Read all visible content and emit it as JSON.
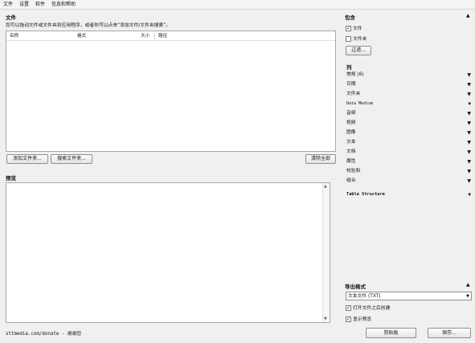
{
  "menu": [
    "文件",
    "设置",
    "软件",
    "信息和帮助"
  ],
  "files": {
    "title": "文件",
    "hint": "您可以拖动文件或文件夹到应用程序，或者你可以点击“添加文件/文件夹搜索”。",
    "columns": {
      "name": "名称",
      "format": "格式",
      "size": "大小",
      "path": "路径"
    },
    "add_files": "添加文件夹...",
    "search_files": "搜索文件夹...",
    "clear_all": "清除全部"
  },
  "preview": {
    "title": "预览"
  },
  "footer": {
    "link": "sttmedia.com/donate - 谢谢您"
  },
  "include": {
    "title": "包含",
    "file_label": "文件",
    "file_checked": true,
    "folder_label": "文件夹",
    "folder_checked": false,
    "filter_button": "过滤..."
  },
  "columns_section": {
    "title": "列",
    "items": [
      "常规 (6)",
      "日期",
      "文件夹",
      "Data Medium",
      "音频",
      "视频",
      "图像",
      "文本",
      "文档",
      "属性",
      "校验和",
      "组合"
    ],
    "table_structure": "Table Structure"
  },
  "export": {
    "title": "导出格式",
    "format_value": "文本文件 (TXT)",
    "open_after_label": "打开文件之后创建",
    "open_after_checked": true,
    "show_preview_label": "显示预览",
    "show_preview_checked": true,
    "clipboard_button": "剪贴板",
    "save_button": "保存..."
  }
}
